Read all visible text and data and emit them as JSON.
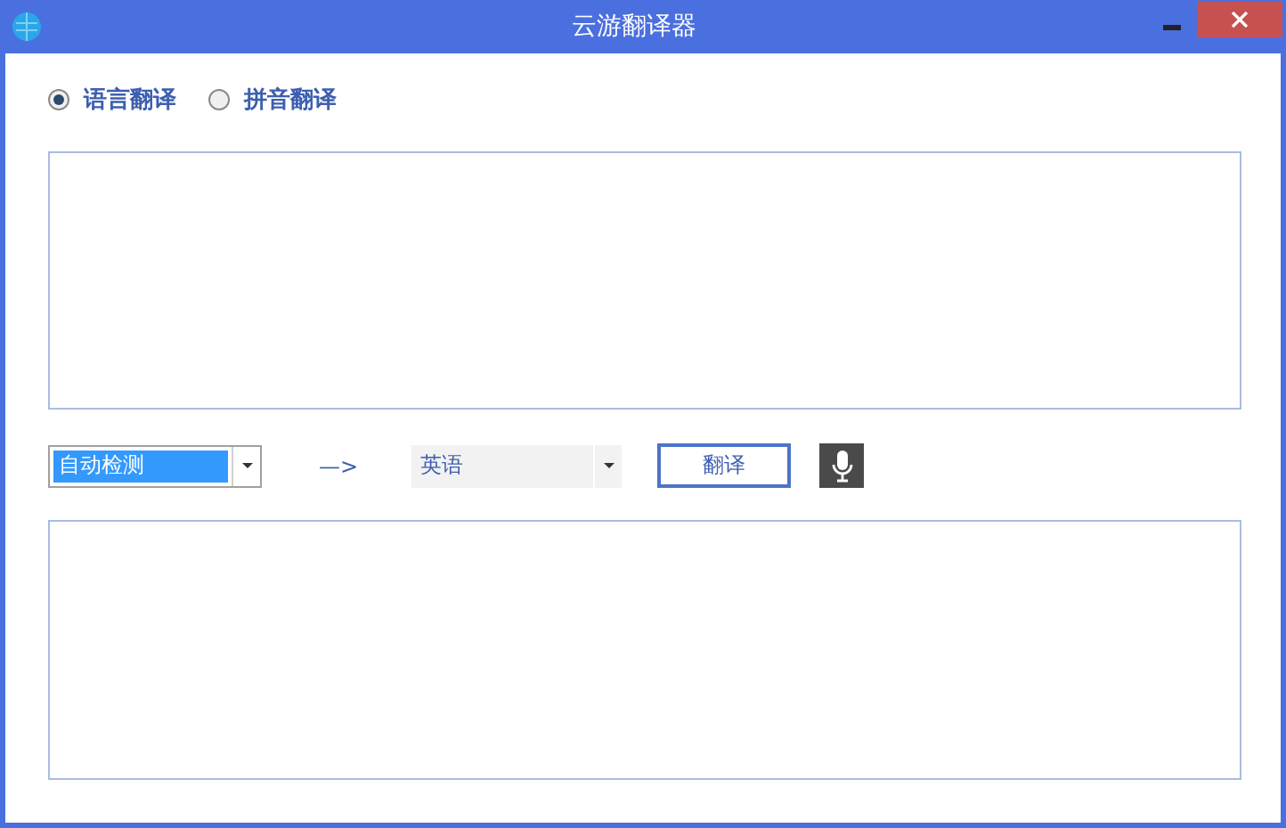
{
  "window": {
    "title": "云游翻译器"
  },
  "modes": [
    {
      "label": "语言翻译",
      "selected": true
    },
    {
      "label": "拼音翻译",
      "selected": false
    }
  ],
  "source_language": {
    "value": "自动检测",
    "highlighted": true
  },
  "direction_arrow": "—>",
  "target_language": {
    "value": "英语"
  },
  "translate_button": "翻译"
}
